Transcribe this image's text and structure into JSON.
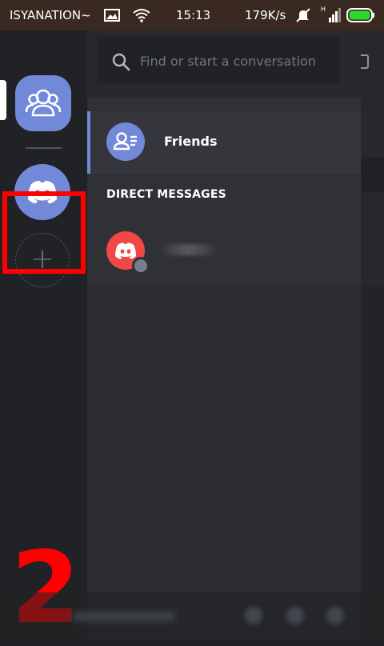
{
  "status_bar": {
    "carrier": "ISYANATION~",
    "time": "15:13",
    "speed": "179K/s"
  },
  "search": {
    "placeholder": "Find or start a conversation"
  },
  "friends": {
    "label": "Friends"
  },
  "direct_messages": {
    "header": "DIRECT MESSAGES"
  },
  "add_server": {
    "glyph": "+"
  },
  "annotation": {
    "step": "2"
  },
  "colors": {
    "blurple": "#7289da",
    "red": "#f04747",
    "highlight": "#ff0000"
  }
}
